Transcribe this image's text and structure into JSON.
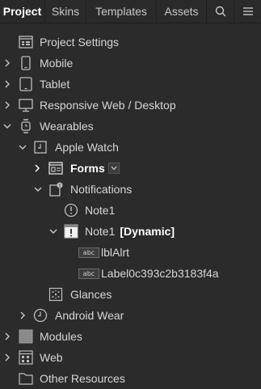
{
  "tabs": [
    {
      "label": "Project",
      "active": true
    },
    {
      "label": "Skins",
      "active": false
    },
    {
      "label": "Templates",
      "active": false
    },
    {
      "label": "Assets",
      "active": false
    }
  ],
  "toolbar_icons": [
    "search-icon",
    "hamburger-menu-icon"
  ],
  "tree": {
    "project_settings": "Project Settings",
    "mobile": "Mobile",
    "tablet": "Tablet",
    "responsive": "Responsive Web / Desktop",
    "wearables": "Wearables",
    "apple_watch": "Apple Watch",
    "forms": "Forms",
    "notifications": "Notifications",
    "note1_a": "Note1",
    "note1_b": "Note1",
    "dynamic": "[Dynamic]",
    "lbl_alrt": "lblAlrt",
    "label_long": "Label0c393c2b3183f4a",
    "badge_text": "abc",
    "glances": "Glances",
    "android_wear": "Android Wear",
    "modules": "Modules",
    "web": "Web",
    "other_resources": "Other Resources"
  },
  "colors": {
    "background": "#2b2b2b",
    "text": "#d6d6d6",
    "text_bold": "#ffffff",
    "icon": "#bdbdbd"
  }
}
